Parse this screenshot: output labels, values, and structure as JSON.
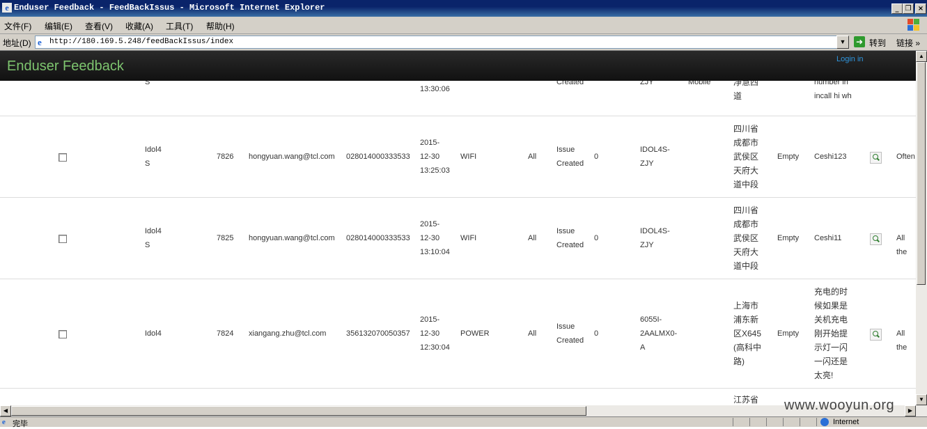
{
  "window": {
    "title": "Enduser Feedback - FeedBackIssus - Microsoft Internet Explorer",
    "minimize": "_",
    "restore": "❐",
    "close": "×"
  },
  "menu": [
    "文件(F)",
    "编辑(E)",
    "查看(V)",
    "收藏(A)",
    "工具(T)",
    "帮助(H)"
  ],
  "address": {
    "label": "地址(D)",
    "url": "http://180.169.5.248/feedBackIssus/index",
    "go": "转到",
    "links": "链接"
  },
  "navbar": {
    "brand": "Enduser Feedback",
    "login": "Login in"
  },
  "partial_row": {
    "model": [
      "S"
    ],
    "time": [
      "13:30:06"
    ],
    "status": [
      "Created"
    ],
    "version": [
      "ZJY"
    ],
    "type": [
      "Mobile"
    ],
    "location": [
      "净慧西",
      "道"
    ],
    "desc": [
      "number in",
      "incall hi wh"
    ]
  },
  "rows": [
    {
      "model": [
        "Idol4",
        "S"
      ],
      "id": "7826",
      "email": "hongyuan.wang@tcl.com",
      "imei": "028014000333533",
      "time": [
        "2015-",
        "12-30",
        "13:25:03"
      ],
      "category": "WIFI",
      "scope": "All",
      "status": [
        "Issue",
        "Created"
      ],
      "count": "0",
      "version": [
        "IDOL4S-",
        "ZJY"
      ],
      "location": [
        "四川省",
        "成都市",
        "武侯区",
        "天府大",
        "道中段"
      ],
      "empty": "Empty",
      "desc": [
        "Ceshi123"
      ],
      "freq": "Often"
    },
    {
      "model": [
        "Idol4",
        "S"
      ],
      "id": "7825",
      "email": "hongyuan.wang@tcl.com",
      "imei": "028014000333533",
      "time": [
        "2015-",
        "12-30",
        "13:10:04"
      ],
      "category": "WIFI",
      "scope": "All",
      "status": [
        "Issue",
        "Created"
      ],
      "count": "0",
      "version": [
        "IDOL4S-",
        "ZJY"
      ],
      "location": [
        "四川省",
        "成都市",
        "武侯区",
        "天府大",
        "道中段"
      ],
      "empty": "Empty",
      "desc": [
        "Ceshi11"
      ],
      "freq": "All the"
    },
    {
      "model": [
        "Idol4"
      ],
      "id": "7824",
      "email": "xiangang.zhu@tcl.com",
      "imei": "356132070050357",
      "time": [
        "2015-",
        "12-30",
        "12:30:04"
      ],
      "category": "POWER",
      "scope": "All",
      "status": [
        "Issue",
        "Created"
      ],
      "count": "0",
      "version": [
        "6055I-",
        "2AALMX0-",
        "A"
      ],
      "location": [
        "上海市",
        "浦东新",
        "区X645",
        "(高科中",
        "路)"
      ],
      "empty": "Empty",
      "desc": [
        "充电的时",
        "候如果是",
        "关机充电",
        "刚开始提",
        "示灯一闪",
        "一闪还是",
        "太亮!"
      ],
      "freq": "All the"
    }
  ],
  "next_row": {
    "location": [
      "江苏省"
    ]
  },
  "status_bar": {
    "text": "完毕",
    "zone": "Internet"
  },
  "watermark": "www.wooyun.org",
  "colors": {
    "brand": "#7ec56f",
    "login_link": "#2f97e0",
    "titlebar": "#0a246a"
  }
}
